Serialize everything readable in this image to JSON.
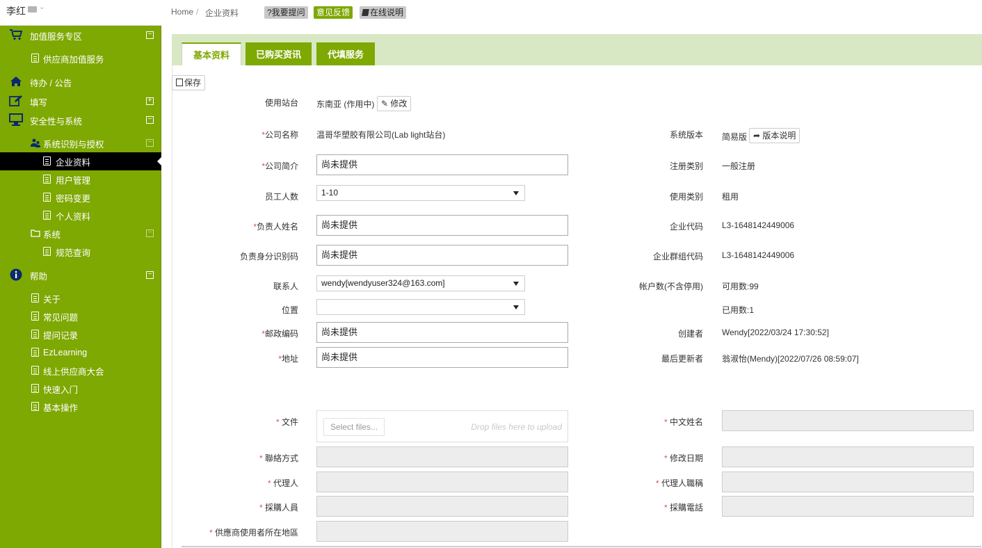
{
  "user": {
    "name": "李红"
  },
  "sidebar": {
    "sections": [
      {
        "key": "vas",
        "label": "加值服务专区",
        "icon": "cart-icon",
        "toggle": "⊟"
      },
      {
        "key": "vas-item",
        "label": "供应商加值服务",
        "icon": "doc-icon"
      },
      {
        "key": "todo",
        "label": "待办 / 公告",
        "icon": "home-icon"
      },
      {
        "key": "fill",
        "label": "填写",
        "icon": "edit-icon",
        "toggle": "⊞"
      },
      {
        "key": "security",
        "label": "安全性与系统",
        "icon": "monitor-icon",
        "toggle": "⊟"
      },
      {
        "key": "auth",
        "label": "系统识别与授权",
        "icon": "users-icon",
        "toggle": "⊟"
      },
      {
        "key": "company",
        "label": "企业资料",
        "icon": "doc-icon",
        "active": true
      },
      {
        "key": "users",
        "label": "用户管理",
        "icon": "doc-icon"
      },
      {
        "key": "pwd",
        "label": "密码变更",
        "icon": "doc-icon"
      },
      {
        "key": "profile",
        "label": "个人资料",
        "icon": "doc-icon"
      },
      {
        "key": "system",
        "label": "系统",
        "icon": "folder-icon",
        "toggle": "⊟"
      },
      {
        "key": "spec",
        "label": "规范查询",
        "icon": "doc-icon"
      },
      {
        "key": "help",
        "label": "帮助",
        "icon": "info-icon",
        "toggle": "⊟"
      },
      {
        "key": "about",
        "label": "关于",
        "icon": "doc-icon"
      },
      {
        "key": "faq",
        "label": "常见问题",
        "icon": "doc-icon"
      },
      {
        "key": "qlog",
        "label": "提问记录",
        "icon": "doc-icon"
      },
      {
        "key": "ezl",
        "label": "EzLearning",
        "icon": "doc-icon"
      },
      {
        "key": "expo",
        "label": "线上供应商大会",
        "icon": "doc-icon"
      },
      {
        "key": "quick",
        "label": "快速入门",
        "icon": "doc-icon"
      },
      {
        "key": "basic",
        "label": "基本操作",
        "icon": "doc-icon"
      }
    ]
  },
  "breadcrumb": {
    "home": "Home",
    "sep": "/",
    "current": "企业资料"
  },
  "topbar": {
    "ask": "?我要提问",
    "feedback": "意见反馈",
    "online": "在线说明"
  },
  "tabs": {
    "basic": "基本资料",
    "bought": "已购买资讯",
    "fill": "代填服务"
  },
  "toolbar": {
    "save": "保存"
  },
  "form": {
    "site_label": "使用站台",
    "site_value": "东南亚 (作用中)",
    "site_edit": "修改",
    "company_name_label": "公司名称",
    "company_name_value": "温哥华塑胶有限公司(Lab light站台)",
    "intro_label": "公司简介",
    "intro_value": "尚未提供",
    "staff_label": "员工人数",
    "staff_value": "1-10",
    "leader_label": "负责人姓名",
    "leader_value": "尚未提供",
    "leader_id_label": "负责身分识别码",
    "leader_id_value": "尚未提供",
    "contact_label": "联系人",
    "contact_value": "wendy[wendyuser324@163.com]",
    "location_label": "位置",
    "location_value": "",
    "zip_label": "邮政编码",
    "zip_value": "尚未提供",
    "address_label": "地址",
    "address_value": "尚未提供",
    "file_label": "文件",
    "select_files": "Select files...",
    "drop_hint": "Drop files here to upload",
    "contact_method_label": "聯絡方式",
    "agent_label": "代理人",
    "buyer_label": "採購人員",
    "region_label": "供應商使用者所在地區"
  },
  "info": {
    "version_label": "系统版本",
    "version_value": "简易版",
    "version_btn": "版本说明",
    "reg_type_label": "注册类别",
    "reg_type_value": "一般注册",
    "use_type_label": "使用类别",
    "use_type_value": "租用",
    "code_label": "企业代码",
    "code_value": "L3-1648142449006",
    "group_code_label": "企业群组代码",
    "group_code_value": "L3-1648142449006",
    "accounts_label": "帐户数(不含停用)",
    "available": "可用数:99",
    "used": "已用数:1",
    "creator_label": "创建者",
    "creator_value": "Wendy[2022/03/24 17:30:52]",
    "updater_label": "最后更新者",
    "updater_value": "翁淑怡(Mendy)[2022/07/26 08:59:07]",
    "cn_name_label": "中文姓名",
    "modify_date_label": "修改日期",
    "agent_title_label": "代理人職稱",
    "buyer_phone_label": "採購電話"
  },
  "colors": {
    "accent": "#7ea802",
    "tab_bg": "#d8e8c4",
    "required": "#d9534f"
  }
}
